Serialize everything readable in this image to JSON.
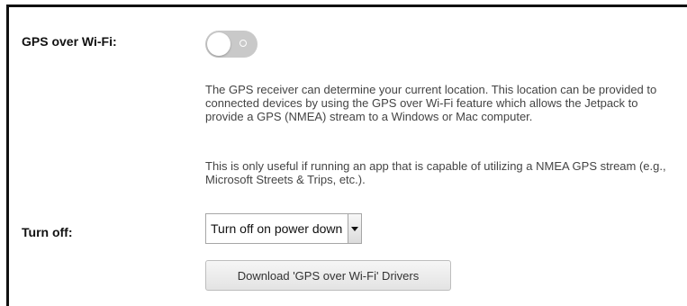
{
  "gps_over_wifi": {
    "label": "GPS over Wi-Fi:",
    "toggle_state": "off",
    "description_1": "The GPS receiver can determine your current location. This location can be provided to connected devices by using the GPS over Wi-Fi feature which allows the Jetpack to provide a GPS (NMEA) stream to a Windows or Mac computer.",
    "description_2": "This is only useful if running an app that is capable of utilizing a NMEA GPS stream (e.g., Microsoft Streets & Trips, etc.)."
  },
  "turn_off": {
    "label": "Turn off:",
    "selected_value": "Turn off on power down"
  },
  "download_button": {
    "label": "Download 'GPS over Wi-Fi' Drivers"
  },
  "icons": {
    "toggle": "toggle-switch-icon",
    "dropdown": "chevron-down-icon"
  },
  "colors": {
    "toggle_off": "#c9c9c9",
    "text": "#444444",
    "label": "#111111"
  }
}
